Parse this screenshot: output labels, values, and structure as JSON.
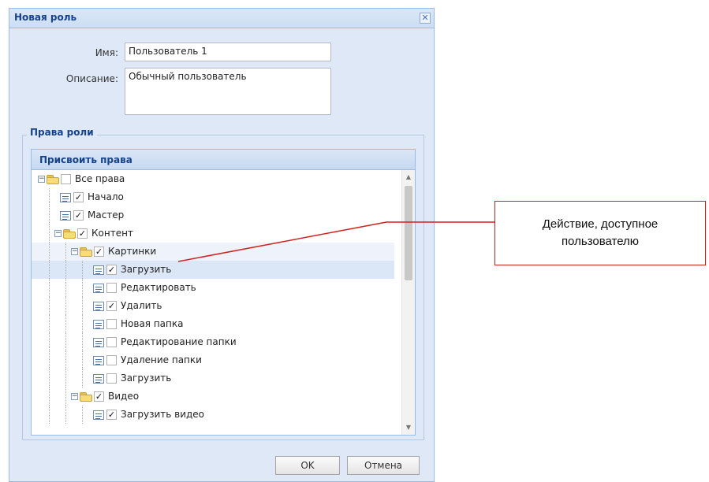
{
  "dialog": {
    "title": "Новая роль",
    "close_glyph": "✕",
    "name_label": "Имя:",
    "name_value": "Пользователь 1",
    "description_label": "Описание:",
    "description_value": "Обычный пользователь",
    "fieldset_legend": "Права роли",
    "panel_header": "Присвоить права",
    "ok_label": "OK",
    "cancel_label": "Отмена"
  },
  "tree": [
    {
      "label": "Все права",
      "type": "folder",
      "level": 0,
      "checked": false,
      "expanded": true
    },
    {
      "label": "Начало",
      "type": "leaf",
      "level": 1,
      "checked": true
    },
    {
      "label": "Мастер",
      "type": "leaf",
      "level": 1,
      "checked": true
    },
    {
      "label": "Контент",
      "type": "folder",
      "level": 1,
      "checked": true,
      "expanded": true
    },
    {
      "label": "Картинки",
      "type": "folder",
      "level": 2,
      "checked": true,
      "expanded": true,
      "highlighted": true
    },
    {
      "label": "Загрузить",
      "type": "leaf",
      "level": 3,
      "checked": true,
      "selected": true
    },
    {
      "label": "Редактировать",
      "type": "leaf",
      "level": 3,
      "checked": false
    },
    {
      "label": "Удалить",
      "type": "leaf",
      "level": 3,
      "checked": true
    },
    {
      "label": "Новая папка",
      "type": "leaf",
      "level": 3,
      "checked": false
    },
    {
      "label": "Редактирование папки",
      "type": "leaf",
      "level": 3,
      "checked": false
    },
    {
      "label": "Удаление папки",
      "type": "leaf",
      "level": 3,
      "checked": false
    },
    {
      "label": "Загрузить",
      "type": "leaf",
      "level": 3,
      "checked": false
    },
    {
      "label": "Видео",
      "type": "folder",
      "level": 2,
      "checked": true,
      "expanded": true
    },
    {
      "label": "Загрузить видео",
      "type": "leaf",
      "level": 3,
      "checked": true
    }
  ],
  "callout": {
    "text": "Действие, доступное пользователю",
    "border_color": "#d0211c"
  },
  "colors": {
    "title_text": "#15428b",
    "dialog_bg": "#dfe8f6",
    "border": "#99bbe8"
  }
}
